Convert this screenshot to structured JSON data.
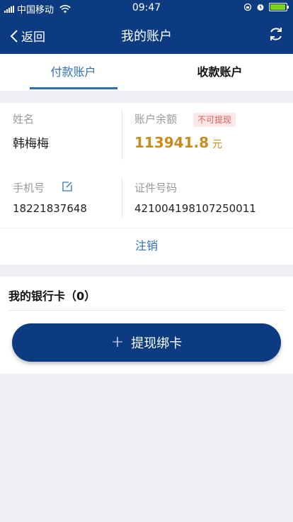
{
  "status_bar": {
    "carrier": "中国移动",
    "time": "09:47"
  },
  "nav": {
    "back_label": "返回",
    "title": "我的账户"
  },
  "tabs": [
    {
      "label": "付款账户",
      "active": true
    },
    {
      "label": "收款账户",
      "active": false
    }
  ],
  "account": {
    "name_label": "姓名",
    "name_value": "韩梅梅",
    "balance_label": "账户余额",
    "balance_badge": "不可提现",
    "balance_value": "113941.8",
    "balance_unit": "元",
    "phone_label": "手机号",
    "phone_value": "18221837648",
    "id_label": "证件号码",
    "id_value": "421004198107250011",
    "cancel_label": "注销"
  },
  "bank_cards": {
    "title": "我的银行卡（0）",
    "add_button_label": "提现绑卡"
  },
  "colors": {
    "primary": "#0c3b82",
    "link": "#2f6fb3",
    "balance": "#c98c1c",
    "badge_text": "#e35b5b",
    "badge_bg": "#fde8e8"
  }
}
